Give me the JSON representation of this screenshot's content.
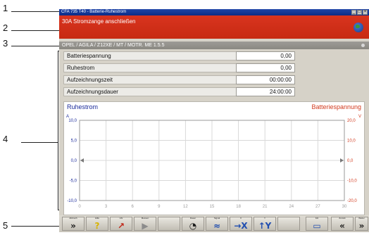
{
  "callouts": [
    "1",
    "2",
    "3",
    "4",
    "5"
  ],
  "window": {
    "title": "CFA 735 T40 - Batterie-Ruhestrom",
    "buttons": [
      "_",
      "□",
      "×"
    ]
  },
  "instruction": "30A Stromzange anschließen",
  "vehicle": "OPEL / AGILA / Z12XE / MT / MOTR. ME 1.5.5",
  "measurements": [
    {
      "label": "Batteriespannung",
      "value": "0,00"
    },
    {
      "label": "Ruhestrom",
      "value": "0,00"
    },
    {
      "label": "Aufzeichnungszeit",
      "value": "00:00:00"
    },
    {
      "label": "Aufzeichnungsdauer",
      "value": "24:00:00"
    }
  ],
  "chart": {
    "left_title": "Ruhestrom",
    "right_title": "Batteriespannung",
    "left_unit": "A",
    "right_unit": "V",
    "left_ticks": [
      "10,0",
      "5,0",
      "0,0",
      "-5,0",
      "-10,0"
    ],
    "right_ticks": [
      "20,0",
      "10,0",
      "0,0",
      "-10,0",
      "-20,0"
    ],
    "x_ticks": [
      "0",
      "3",
      "6",
      "9",
      "12",
      "15",
      "18",
      "21",
      "24",
      "27",
      "30"
    ],
    "left_color": "#1a2a9a",
    "right_color": "#d23a1e"
  },
  "chart_data": {
    "type": "line",
    "title": "",
    "xlabel": "",
    "ylabel": "Ruhestrom",
    "y2label": "Batteriespannung",
    "x_range": [
      0,
      30
    ],
    "ylim": [
      -10,
      10
    ],
    "y2lim": [
      -20,
      20
    ],
    "grid": true,
    "series": []
  },
  "toolbar": [
    {
      "caption": "Abbruch",
      "icon": "»"
    },
    {
      "caption": "Hilfe",
      "icon": "?"
    },
    {
      "caption": "Uhr",
      "icon": "↗"
    },
    {
      "caption": "Messen",
      "icon": "▶"
    },
    {
      "caption": "",
      "icon": ""
    },
    {
      "caption": "Dauer",
      "icon": "◔"
    },
    {
      "caption": "Signal",
      "icon": "≈"
    },
    {
      "caption": "X",
      "icon": "→X"
    },
    {
      "caption": "Y",
      "icon": "↑Y"
    },
    {
      "caption": "",
      "icon": ""
    },
    {
      "caption": "Fdt",
      "icon": "▭"
    },
    {
      "caption": "Zurück",
      "icon": "«"
    },
    {
      "caption": "Weiter",
      "icon": "»"
    }
  ]
}
